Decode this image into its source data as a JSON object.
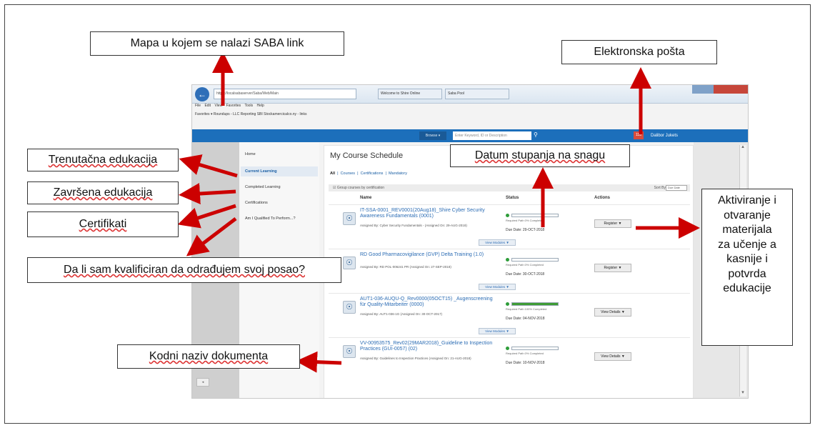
{
  "browser": {
    "address": "https://localsabaserver/Saba/Web/Main",
    "tabs": [
      "Welcome to Shire Online",
      "Saba Pool"
    ],
    "menu": "File Edit View Favorites Tools Help",
    "favorites": "Favorites ▾  Roundups - LLC Reporting  SBI Stockamercicalco.ny - links"
  },
  "header": {
    "browse_label": "Browse ▾",
    "search_placeholder": "Enter Keyword, ID or Description",
    "mail_badge": "118",
    "user_name": "Dalibor Jukets"
  },
  "sidebar": {
    "items": [
      {
        "label": "Home"
      },
      {
        "label": "Current Learning"
      },
      {
        "label": "Completed Learning"
      },
      {
        "label": "Certifications"
      },
      {
        "label": "Am I Qualified To Perform...?"
      }
    ]
  },
  "main": {
    "title": "My Course Schedule",
    "filters": {
      "all": "All",
      "courses": "Courses",
      "certifications": "Certifications",
      "mandatory": "Mandatory"
    },
    "group_label": "Group courses by certification",
    "sort_label": "Sort By",
    "sort_value": "Due Date",
    "columns": {
      "name": "Name",
      "status": "Status",
      "actions": "Actions"
    },
    "rows": [
      {
        "title": "IT-SSA-0001_REV0001(20Aug18)_Shire Cyber Security Awareness Fundamentals (0001)",
        "assigned": "Assigned By: Cyber Security Fundamentals - (Assigned On: 29-AUG-2018)",
        "status_text": "Required Path 0% Completed",
        "progress": 0,
        "due": "Due Date: 29-OCT-2018",
        "action": "Register ▼",
        "view": "View Modules ▼"
      },
      {
        "title": "RD Good Pharmacovigilance (GVP) Delta Training (1.0)",
        "assigned": "Assigned By: RD POL-006241 PR (Assigned On: 27-SEP-2018)",
        "status_text": "Required Path 0% Completed",
        "progress": 0,
        "due": "Due Date: 30-OCT-2018",
        "action": "Register ▼",
        "view": "View Modules ▼"
      },
      {
        "title": "AUT1-036-AUQU-Q_Rev0000(05OCT15) _Augenscreening für Quality-Mitarbeiter (0000)",
        "assigned": "Assigned By: AUT1-036-1G (Assigned On: 30-OCT-2017)",
        "status_text": "Required Path 100% Completed",
        "progress": 1,
        "due": "Due Date: 04-NOV-2018",
        "action": "View Details ▼",
        "view": "View Modules ▼"
      },
      {
        "title": "VV-00953575_Rev02(29MAR2018)_Guideline to Inspection Practices (GUI-0057) (02)",
        "assigned": "Assigned By: Guidelines to Inspection Practices (Assigned On: 21-AUG-2018)",
        "status_text": "Required Path 0% Completed",
        "progress": 0,
        "due": "Due Date: 10-NOV-2018",
        "action": "View Details ▼",
        "view": ""
      }
    ]
  },
  "annotations": {
    "saba_link": "Mapa u kojem se nalazi SABA link",
    "email": "Elektronska pošta",
    "current": "Trenutačna edukacija",
    "completed": "Završena edukacija",
    "certificates": "Certifikati",
    "due_date": "Datum stupanja na snagu",
    "qualified": "Da li sam kvalificiran da odrađujem svoj posao?",
    "doc_code": "Kodni naziv dokumenta",
    "activation_lines": [
      "Aktiviranje i",
      "otvaranje",
      "materijala",
      "za učenje a",
      "kasnije i",
      "potvrda",
      "edukacije"
    ]
  },
  "colors": {
    "arrow": "#cc0000",
    "saba_blue": "#1c6fbb",
    "link_blue": "#2b6cb4",
    "progress_green": "#3f9c35"
  }
}
